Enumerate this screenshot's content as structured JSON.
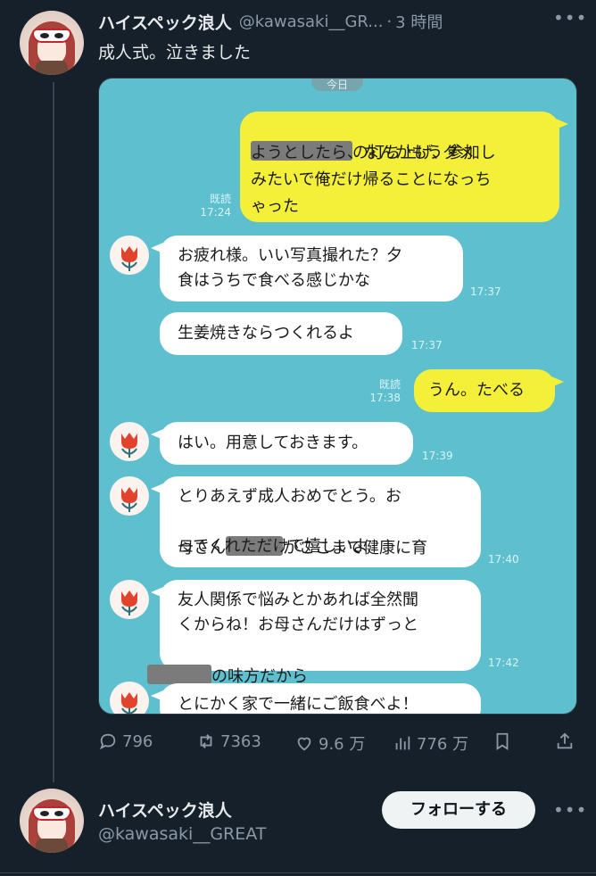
{
  "tweet": {
    "display_name": "ハイスペック浪人",
    "handle": "@kawasaki__GR...",
    "separator": "·",
    "time": "3 時間",
    "text": "成人式。泣きました"
  },
  "chat": {
    "date_label": "今日",
    "messages": [
      {
        "from": "me",
        "lines": [
          "の打ち上げ、参加し",
          "ようとしたら、なんかもうダメ",
          "みたいで俺だけ帰ることになっち",
          "ゃった"
        ],
        "read": "既読",
        "time": "17:24"
      },
      {
        "from": "mom",
        "lines": [
          "お疲れ様。いい写真撮れた？夕",
          "食はうちで食べる感じかな"
        ],
        "time": "17:37"
      },
      {
        "from": "mom",
        "lines": [
          "生姜焼きならつくれるよ"
        ],
        "time": "17:37"
      },
      {
        "from": "me",
        "lines": [
          "うん。たべる"
        ],
        "read": "既読",
        "time": "17:38"
      },
      {
        "from": "mom",
        "lines": [
          "はい。用意しておきます。"
        ],
        "time": "17:39"
      },
      {
        "from": "mom",
        "lines": [
          "とりあえず成人おめでとう。お",
          "母さん",
          "がここまで健康に育",
          "ってくれただけで嬉しいよ"
        ],
        "time": "17:40"
      },
      {
        "from": "mom",
        "lines": [
          "友人関係で悩みとかあれば全然聞",
          "くからね！お母さんだけはずっと",
          "の味方だから"
        ],
        "time": "17:42"
      },
      {
        "from": "mom",
        "lines": [
          "とにかく家で一緒にご飯食べよ！"
        ],
        "time": ""
      }
    ]
  },
  "actions": {
    "replies": "796",
    "retweets": "7363",
    "likes": "9.6 万",
    "views": "776 万"
  },
  "author_card": {
    "display_name": "ハイスペック浪人",
    "handle": "@kawasaki__GREAT",
    "follow_label": "フォローする"
  },
  "icons": [
    "more-icon",
    "reply-icon",
    "retweet-icon",
    "like-icon",
    "views-icon",
    "bookmark-icon",
    "share-icon",
    "tulip-avatar-icon"
  ],
  "colors": {
    "background": "#15202b",
    "chat_background": "#5ebfcf",
    "outgoing_bubble": "#f4f039",
    "incoming_bubble": "#ffffff",
    "muted_text": "#8b98a5"
  }
}
